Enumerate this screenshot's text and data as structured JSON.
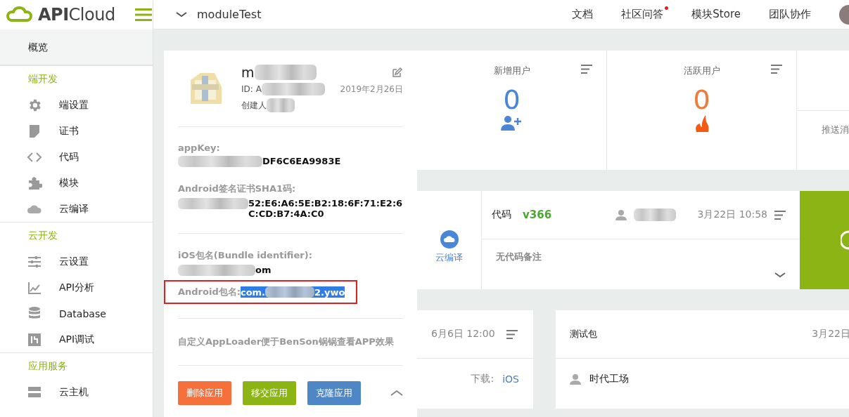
{
  "brand": {
    "name_bold": "API",
    "name_light": "Cloud"
  },
  "topbar": {
    "project": "moduleTest",
    "nav": [
      {
        "label": "文档",
        "dot": false
      },
      {
        "label": "社区问答",
        "dot": true
      },
      {
        "label": "模块Store",
        "dot": false
      },
      {
        "label": "团队协作",
        "dot": false
      }
    ]
  },
  "sidebar": {
    "items": [
      {
        "kind": "top",
        "label": "概览",
        "selected": true
      },
      {
        "kind": "section",
        "label": "端开发"
      },
      {
        "kind": "item",
        "label": "端设置",
        "selected": false
      },
      {
        "kind": "item",
        "label": "证书",
        "selected": false
      },
      {
        "kind": "item",
        "label": "代码",
        "selected": false
      },
      {
        "kind": "item",
        "label": "模块",
        "selected": false
      },
      {
        "kind": "item",
        "label": "云编译",
        "selected": false
      },
      {
        "kind": "section",
        "label": "云开发"
      },
      {
        "kind": "item",
        "label": "云设置",
        "selected": false
      },
      {
        "kind": "item",
        "label": "API分析",
        "selected": false
      },
      {
        "kind": "item",
        "label": "Database",
        "selected": false
      },
      {
        "kind": "item",
        "label": "API调试",
        "selected": false
      },
      {
        "kind": "section",
        "label": "应用服务"
      },
      {
        "kind": "item",
        "label": "云主机",
        "selected": false
      }
    ]
  },
  "app_card": {
    "name": "m",
    "id": "ID: A",
    "created": "2019年2月26日",
    "creator": "创建人",
    "fields": [
      {
        "label": "appKey:",
        "value": "DF6C6EA9983E"
      },
      {
        "label": "Android签名证书SHA1码:",
        "value": "52:E6:A6:5E:B2:18:6F:71:E2:6C:CD:B7:4A:C0"
      },
      {
        "label": "iOS包名(Bundle identifier):",
        "value": "om"
      }
    ],
    "android_package": {
      "label": "Android包名:",
      "value_start": "com.",
      "value_end": "2.ywo"
    },
    "description": "自定义AppLoader便于BenSon锅锅查看APP效果",
    "buttons": [
      {
        "label": "删除应用",
        "color": "#f5703a"
      },
      {
        "label": "移交应用",
        "color": "#8cb414"
      },
      {
        "label": "克隆应用",
        "color": "#4f86c6"
      }
    ]
  },
  "stats": [
    {
      "title": "新增用户",
      "value": "0",
      "color": "#4a86d8"
    },
    {
      "title": "活跃用户",
      "value": "0",
      "color": "#f07a3a"
    }
  ],
  "stat_partial": {
    "label": "推送消"
  },
  "compile_step": {
    "label": "云编译"
  },
  "code_panel": {
    "label": "代码",
    "version": "v366",
    "time": "3月22日 10:58",
    "note": "无代码备注"
  },
  "package_card": {
    "time": "6月6日 12:00",
    "download_label": "下载:",
    "download_link": "iOS"
  },
  "test_card": {
    "title": "测试包",
    "time": "3月22日",
    "owner": "时代工场"
  }
}
